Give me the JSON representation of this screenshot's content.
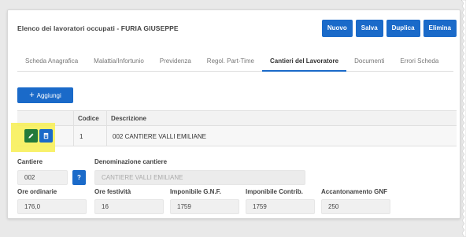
{
  "header": {
    "title": "Elenco dei lavoratori occupati - FURIA GIUSEPPE",
    "buttons": {
      "new": "Nuovo",
      "save": "Salva",
      "duplicate": "Duplica",
      "delete": "Elimina"
    }
  },
  "tabs": [
    {
      "label": "Scheda Anagrafica",
      "active": false
    },
    {
      "label": "Malattia/Infortunio",
      "active": false
    },
    {
      "label": "Previdenza",
      "active": false
    },
    {
      "label": "Regol. Part-Time",
      "active": false
    },
    {
      "label": "Cantieri del Lavoratore",
      "active": true
    },
    {
      "label": "Documenti",
      "active": false
    },
    {
      "label": "Errori Scheda",
      "active": false
    }
  ],
  "add_button": {
    "label": "Aggiungi",
    "icon": "plus-icon"
  },
  "grid": {
    "columns": {
      "codice": "Codice",
      "descrizione": "Descrizione"
    },
    "rows": [
      {
        "codice": "1",
        "descrizione": "002 CANTIERE VALLI EMILIANE"
      }
    ]
  },
  "form": {
    "cantiere": {
      "label": "Cantiere",
      "value": "002",
      "lookup_label": "?"
    },
    "denominazione": {
      "label": "Denominazione cantiere",
      "value": "CANTIERE VALLI EMILIANE"
    },
    "ore_ordinarie": {
      "label": "Ore ordinarie",
      "value": "176,0"
    },
    "ore_festivita": {
      "label": "Ore festività",
      "value": "16"
    },
    "imponibile_gnf": {
      "label": "Imponibile G.N.F.",
      "value": "1759"
    },
    "imponibile_contrib": {
      "label": "Imponibile Contrib.",
      "value": "1759"
    },
    "accantonamento_gnf": {
      "label": "Accantonamento GNF",
      "value": "250"
    }
  },
  "colors": {
    "primary": "#1a6ac9",
    "edit": "#237a3b",
    "highlight": "#f7f05a"
  }
}
